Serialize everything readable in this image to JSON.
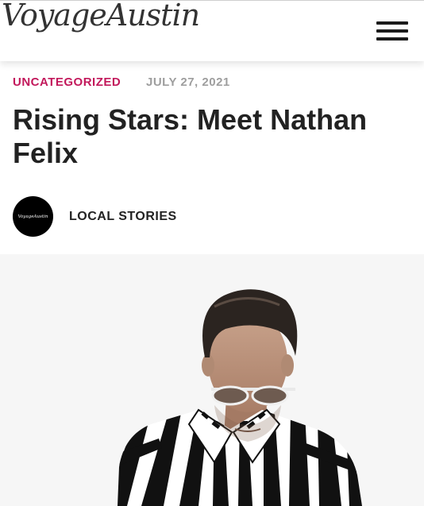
{
  "header": {
    "logo_text": "VoyageAustin",
    "menu_icon": "hamburger-menu-icon"
  },
  "article": {
    "category": "UNCATEGORIZED",
    "date": "JULY 27, 2021",
    "title": "Rising Stars: Meet Nathan Felix",
    "author": {
      "avatar_text": "VoyageAustin",
      "name": "LOCAL STORIES"
    }
  },
  "colors": {
    "category": "#c2185b",
    "date": "#9e9e9e",
    "title": "#222222"
  }
}
